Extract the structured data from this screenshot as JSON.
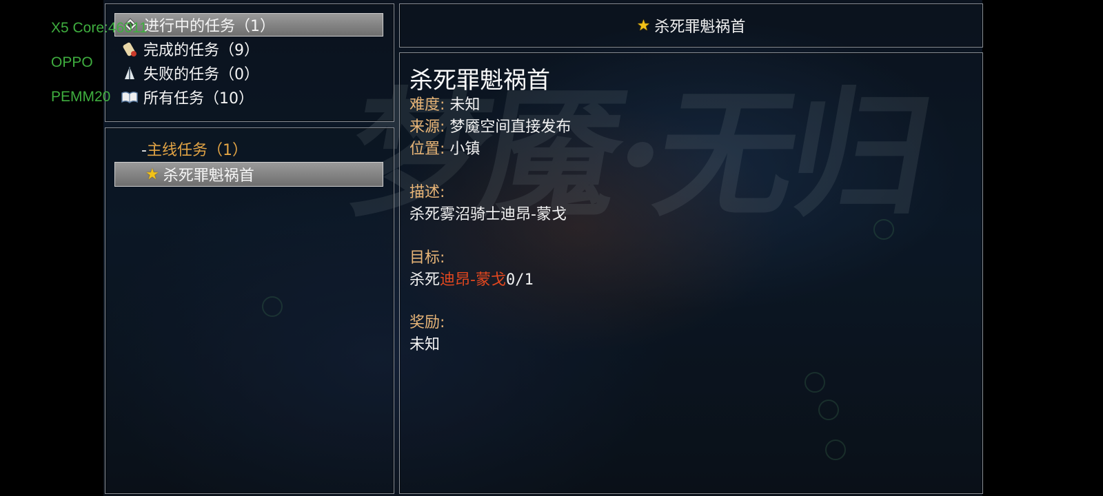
{
  "debug_overlay": {
    "line1": "X5 Core:46011",
    "line2": "OPPO",
    "line3": "PEMM20"
  },
  "categories": [
    {
      "label": "进行中的任务（1）",
      "icon": "diamond-icon",
      "selected": true
    },
    {
      "label": "完成的任务（9）",
      "icon": "scroll-icon",
      "selected": false
    },
    {
      "label": "失败的任务（0）",
      "icon": "broken-sail-icon",
      "selected": false
    },
    {
      "label": "所有任务（10）",
      "icon": "book-icon",
      "selected": false
    }
  ],
  "quest_list": {
    "group_prefix": "-",
    "group_label": "主线任务（1）",
    "items": [
      {
        "label": "杀死罪魁祸首",
        "icon": "star-icon",
        "selected": true
      }
    ]
  },
  "detail": {
    "header_title": "杀死罪魁祸首",
    "name": "杀死罪魁祸首",
    "difficulty_label": "难度:",
    "difficulty_value": "未知",
    "source_label": "来源:",
    "source_value": "梦魇空间直接发布",
    "location_label": "位置:",
    "location_value": "小镇",
    "description_label": "描述:",
    "description_value": "杀死雾沼骑士迪昂-蒙戈",
    "objective_label": "目标:",
    "objective_prefix": "杀死",
    "objective_target": "迪昂-蒙戈",
    "objective_progress": "0/1",
    "reward_label": "奖励:",
    "reward_value": "未知"
  },
  "colors": {
    "label_gold": "#e8b577",
    "group_orange": "#e2a445",
    "target_red": "#e2471f",
    "star_yellow": "#f2c218",
    "debug_green": "#3fae3f"
  }
}
